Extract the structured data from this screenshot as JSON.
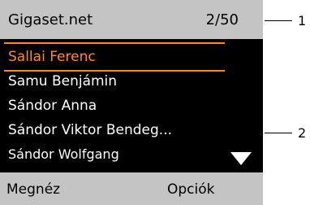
{
  "header": {
    "title": "Gigaset.net",
    "counter": "2/50"
  },
  "contacts": [
    {
      "label": "Sallai Ferenc",
      "selected": true
    },
    {
      "label": "Samu Benjámin",
      "selected": false
    },
    {
      "label": "Sándor Anna",
      "selected": false
    },
    {
      "label": "Sándor Viktor Bendeg...",
      "selected": false
    },
    {
      "label": "Sándor Wolfgang",
      "selected": false
    }
  ],
  "softkeys": {
    "left": "Megnéz",
    "right": "Opciók"
  },
  "callouts": {
    "header": "1",
    "list": "2"
  },
  "colors": {
    "highlight": "#ff8a26",
    "bar": "#c4c4c4",
    "screen": "#000000"
  },
  "icons": {
    "scroll_down": "triangle-down-icon"
  }
}
